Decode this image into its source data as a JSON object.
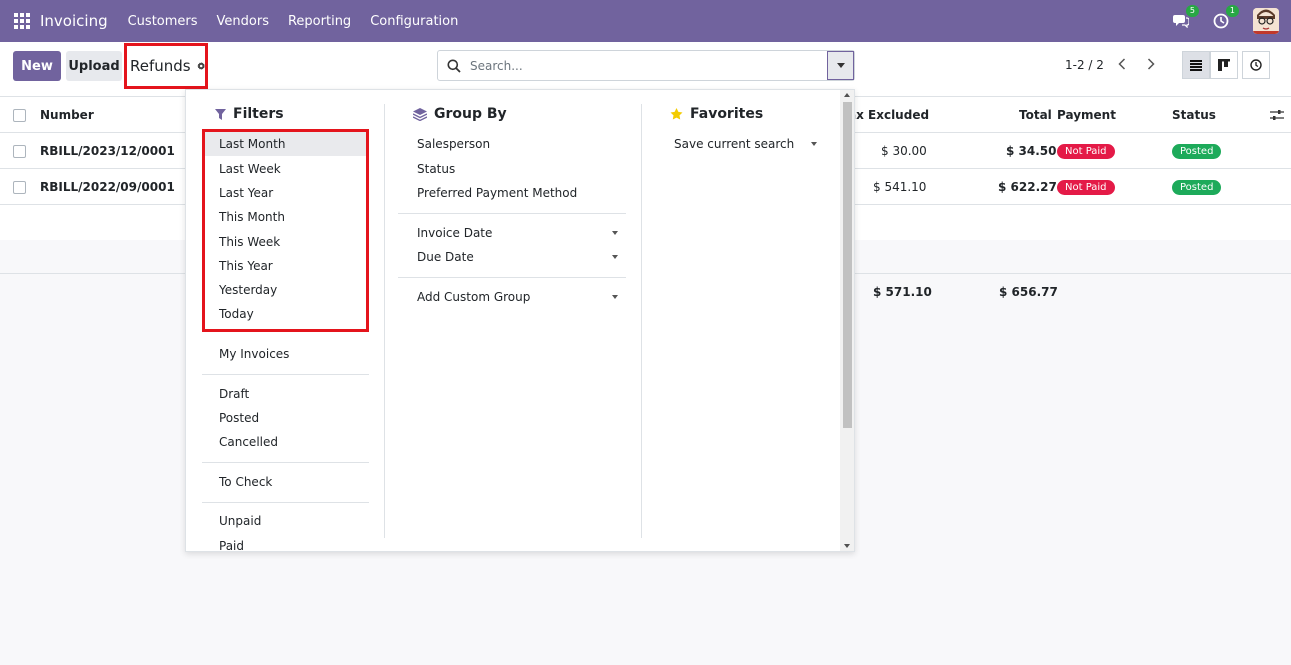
{
  "navbar": {
    "app_name": "Invoicing",
    "menu": [
      "Customers",
      "Vendors",
      "Reporting",
      "Configuration"
    ],
    "messages_count": "5",
    "activities_count": "1",
    "color": "#71639e"
  },
  "control_panel": {
    "new_label": "New",
    "upload_label": "Upload",
    "breadcrumb": "Refunds",
    "search_placeholder": "Search...",
    "pager": "1-2 / 2"
  },
  "list": {
    "columns": [
      "Number",
      "ax Excluded",
      "Total",
      "Payment",
      "Status"
    ],
    "rows": [
      {
        "number": "RBILL/2023/12/0001",
        "tax_excluded": "$ 30.00",
        "total": "$ 34.50",
        "payment": "Not Paid",
        "status": "Posted"
      },
      {
        "number": "RBILL/2022/09/0001",
        "tax_excluded": "$ 541.10",
        "total": "$ 622.27",
        "payment": "Not Paid",
        "status": "Posted"
      }
    ],
    "totals": {
      "tax_excluded": "$ 571.10",
      "total": "$ 656.77"
    }
  },
  "filters": {
    "title": "Filters",
    "date_items": [
      "Last Month",
      "Last Week",
      "Last Year",
      "This Month",
      "This Week",
      "This Year",
      "Yesterday",
      "Today"
    ],
    "my_invoices": "My Invoices",
    "state_items": [
      "Draft",
      "Posted",
      "Cancelled"
    ],
    "to_check": "To Check",
    "payment_items": [
      "Unpaid",
      "Paid"
    ]
  },
  "group_by": {
    "title": "Group By",
    "items": [
      "Salesperson",
      "Status",
      "Preferred Payment Method"
    ],
    "date_items": [
      "Invoice Date",
      "Due Date"
    ],
    "custom": "Add Custom Group"
  },
  "favorites": {
    "title": "Favorites",
    "save": "Save current search"
  },
  "colors": {
    "not_paid": "#e41a47",
    "posted": "#1daa5a",
    "highlight": "#e4141c"
  }
}
